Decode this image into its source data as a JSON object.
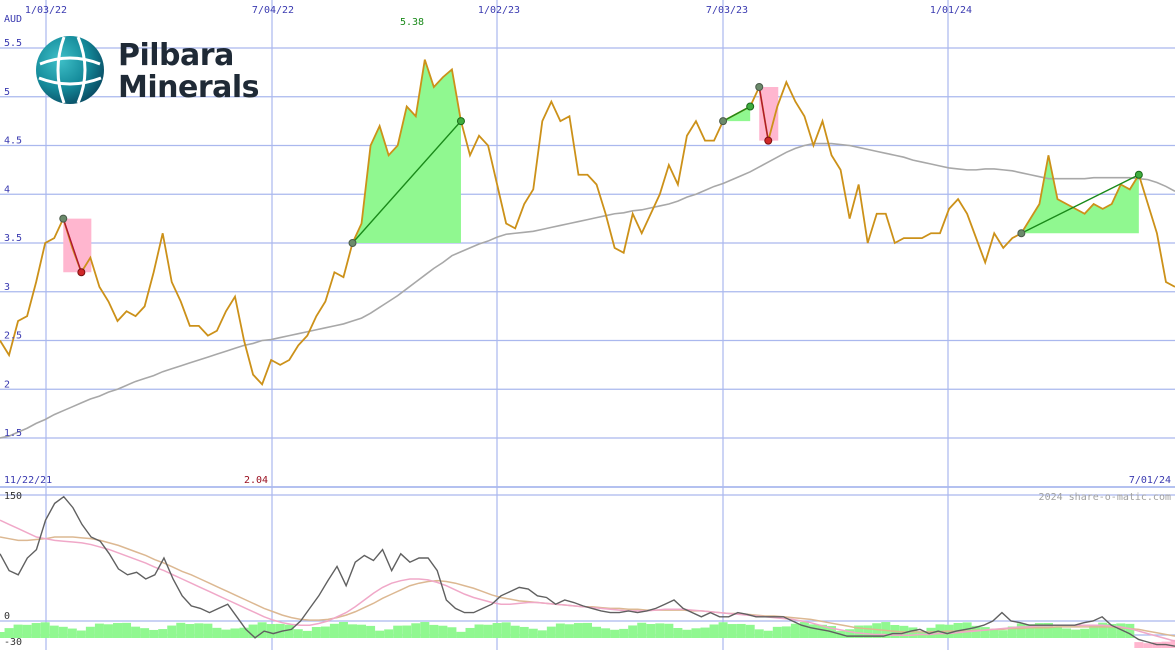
{
  "logo": {
    "line1": "Pilbara",
    "line2": "Minerals"
  },
  "watermark": "2024 share-o-matic.com",
  "colors": {
    "grid": "#aab8ee",
    "price": "#cc9119",
    "ma": "#a8a8a8",
    "gain_fill": "#90f890",
    "loss_fill": "#ffb6cf",
    "gain_line": "#1a8a1a",
    "loss_line": "#b01530",
    "osc": "#606060",
    "osc_pink": "#f0a8c8",
    "osc_tan": "#dcb892",
    "volume_green": "#90f890",
    "volume_pink": "#ffb6cf",
    "axis_text": "#3a3ab0",
    "max_label": "#1a8a1a",
    "min_label": "#9a1020"
  },
  "chart_data": [
    {
      "type": "line",
      "ylabel": "AUD",
      "ylim": [
        1.25,
        5.5
      ],
      "yticks": [
        "1.5",
        "2",
        "2.5",
        "3",
        "3.5",
        "4",
        "4.5",
        "5",
        "5.5"
      ],
      "x_top_ticks": [
        "1/03/22",
        "7/04/22",
        "1/02/23",
        "7/03/23",
        "1/01/24"
      ],
      "x_bottom_ticks": [
        "11/22/21",
        "7/01/24"
      ],
      "max_label": "5.38",
      "min_label": "2.04",
      "grid": true,
      "series": [
        {
          "values": [
            2.5,
            2.35,
            2.7,
            2.75,
            3.1,
            3.5,
            3.55,
            3.75,
            3.45,
            3.2,
            3.35,
            3.05,
            2.9,
            2.7,
            2.8,
            2.75,
            2.85,
            3.2,
            3.6,
            3.1,
            2.9,
            2.65,
            2.65,
            2.55,
            2.6,
            2.8,
            2.95,
            2.5,
            2.15,
            2.05,
            2.3,
            2.25,
            2.3,
            2.45,
            2.55,
            2.75,
            2.9,
            3.2,
            3.15,
            3.5,
            3.7,
            4.5,
            4.7,
            4.4,
            4.5,
            4.9,
            4.8,
            5.38,
            5.1,
            5.2,
            5.28,
            4.75,
            4.4,
            4.6,
            4.5,
            4.1,
            3.7,
            3.65,
            3.9,
            4.05,
            4.75,
            4.95,
            4.75,
            4.8,
            4.2,
            4.2,
            4.1,
            3.8,
            3.45,
            3.4,
            3.8,
            3.6,
            3.8,
            4.0,
            4.3,
            4.1,
            4.6,
            4.75,
            4.55,
            4.55,
            4.75,
            4.8,
            4.85,
            4.9,
            5.1,
            4.55,
            4.9,
            5.15,
            4.95,
            4.8,
            4.5,
            4.75,
            4.4,
            4.25,
            3.75,
            4.1,
            3.5,
            3.8,
            3.8,
            3.5,
            3.55,
            3.55,
            3.55,
            3.6,
            3.6,
            3.85,
            3.95,
            3.8,
            3.55,
            3.3,
            3.6,
            3.45,
            3.55,
            3.6,
            3.75,
            3.9,
            4.4,
            3.95,
            3.9,
            3.85,
            3.8,
            3.9,
            3.85,
            3.9,
            4.1,
            4.05,
            4.2,
            3.9,
            3.6,
            3.1,
            3.05
          ]
        },
        {
          "values": [
            1.5,
            1.52,
            1.56,
            1.6,
            1.65,
            1.69,
            1.74,
            1.78,
            1.82,
            1.86,
            1.9,
            1.93,
            1.97,
            2.0,
            2.04,
            2.08,
            2.11,
            2.14,
            2.18,
            2.21,
            2.24,
            2.27,
            2.3,
            2.33,
            2.36,
            2.39,
            2.42,
            2.45,
            2.47,
            2.5,
            2.51,
            2.53,
            2.55,
            2.57,
            2.59,
            2.61,
            2.63,
            2.65,
            2.67,
            2.7,
            2.73,
            2.78,
            2.84,
            2.9,
            2.96,
            3.03,
            3.1,
            3.17,
            3.24,
            3.3,
            3.37,
            3.41,
            3.45,
            3.49,
            3.52,
            3.56,
            3.59,
            3.6,
            3.61,
            3.62,
            3.64,
            3.66,
            3.68,
            3.7,
            3.72,
            3.74,
            3.76,
            3.78,
            3.8,
            3.81,
            3.83,
            3.84,
            3.86,
            3.88,
            3.9,
            3.93,
            3.97,
            4.0,
            4.04,
            4.08,
            4.11,
            4.15,
            4.19,
            4.23,
            4.28,
            4.33,
            4.38,
            4.43,
            4.47,
            4.5,
            4.52,
            4.52,
            4.52,
            4.51,
            4.5,
            4.48,
            4.46,
            4.44,
            4.42,
            4.4,
            4.38,
            4.35,
            4.33,
            4.31,
            4.29,
            4.27,
            4.26,
            4.25,
            4.25,
            4.26,
            4.26,
            4.25,
            4.24,
            4.22,
            4.2,
            4.18,
            4.16,
            4.16,
            4.16,
            4.16,
            4.16,
            4.17,
            4.17,
            4.17,
            4.17,
            4.17,
            4.16,
            4.15,
            4.12,
            4.08,
            4.03
          ]
        }
      ]
    },
    {
      "type": "line",
      "ylim": [
        -30,
        150
      ],
      "yticks": [
        "150",
        "0",
        "-30"
      ],
      "grid": true,
      "series": [
        {
          "values": [
            80,
            60,
            55,
            75,
            85,
            120,
            140,
            148,
            135,
            115,
            100,
            95,
            80,
            62,
            55,
            58,
            50,
            55,
            75,
            50,
            30,
            18,
            15,
            10,
            15,
            20,
            5,
            -10,
            -20,
            -12,
            -15,
            -12,
            -10,
            0,
            15,
            30,
            48,
            65,
            42,
            70,
            78,
            72,
            85,
            60,
            80,
            70,
            75,
            75,
            60,
            25,
            15,
            10,
            10,
            15,
            20,
            30,
            35,
            40,
            38,
            30,
            28,
            20,
            25,
            22,
            18,
            15,
            12,
            10,
            10,
            12,
            10,
            12,
            15,
            20,
            25,
            15,
            10,
            5,
            10,
            5,
            5,
            10,
            8,
            5,
            5,
            5,
            5,
            0,
            -5,
            -8,
            -10,
            -12,
            -15,
            -18,
            -18,
            -18,
            -18,
            -18,
            -15,
            -15,
            -12,
            -10,
            -15,
            -12,
            -15,
            -12,
            -10,
            -8,
            -5,
            0,
            10,
            0,
            -2,
            -5,
            -5,
            -5,
            -5,
            -5,
            -5,
            -2,
            0,
            5,
            -5,
            -10,
            -15,
            -22,
            -25,
            -28,
            -28,
            -30
          ]
        },
        {
          "values": [
            120,
            115,
            110,
            105,
            100,
            98,
            96,
            95,
            94,
            93,
            91,
            88,
            85,
            81,
            77,
            73,
            69,
            64,
            60,
            55,
            50,
            45,
            40,
            35,
            30,
            25,
            20,
            15,
            10,
            5,
            1,
            -2,
            -4,
            -5,
            -5,
            -3,
            0,
            5,
            10,
            17,
            25,
            33,
            40,
            45,
            48,
            50,
            50,
            49,
            46,
            42,
            37,
            32,
            28,
            25,
            22,
            20,
            20,
            21,
            22,
            22,
            21,
            20,
            19,
            18,
            17,
            16,
            15,
            14,
            13,
            12,
            12,
            12,
            13,
            14,
            14,
            14,
            13,
            12,
            11,
            10,
            9,
            8,
            7,
            6,
            5,
            4,
            3,
            2,
            0,
            -2,
            -5,
            -8,
            -10,
            -12,
            -14,
            -15,
            -16,
            -16,
            -17,
            -17,
            -17,
            -16,
            -16,
            -15,
            -15,
            -14,
            -13,
            -12,
            -11,
            -10,
            -9,
            -8,
            -7,
            -7,
            -6,
            -6,
            -5,
            -5,
            -5,
            -5,
            -5,
            -5,
            -6,
            -7,
            -9,
            -12,
            -15,
            -18,
            -21,
            -24
          ]
        },
        {
          "values": [
            100,
            98,
            96,
            96,
            97,
            98,
            100,
            100,
            100,
            99,
            98,
            96,
            93,
            90,
            86,
            82,
            78,
            73,
            69,
            64,
            59,
            55,
            50,
            45,
            40,
            35,
            30,
            25,
            20,
            15,
            11,
            7,
            4,
            2,
            1,
            1,
            2,
            4,
            7,
            11,
            16,
            21,
            27,
            32,
            37,
            42,
            45,
            47,
            48,
            47,
            45,
            42,
            39,
            35,
            31,
            28,
            26,
            24,
            23,
            22,
            21,
            20,
            19,
            18,
            17,
            17,
            16,
            15,
            15,
            14,
            14,
            13,
            13,
            13,
            13,
            13,
            12,
            12,
            11,
            10,
            9,
            9,
            8,
            7,
            6,
            6,
            5,
            4,
            3,
            2,
            0,
            -2,
            -4,
            -6,
            -8,
            -9,
            -10,
            -11,
            -12,
            -13,
            -13,
            -13,
            -13,
            -13,
            -12,
            -12,
            -12,
            -11,
            -11,
            -10,
            -10,
            -9,
            -9,
            -8,
            -8,
            -8,
            -7,
            -7,
            -7,
            -7,
            -7,
            -7,
            -7,
            -8,
            -9,
            -10,
            -12,
            -14,
            -16,
            -18
          ]
        }
      ]
    }
  ]
}
